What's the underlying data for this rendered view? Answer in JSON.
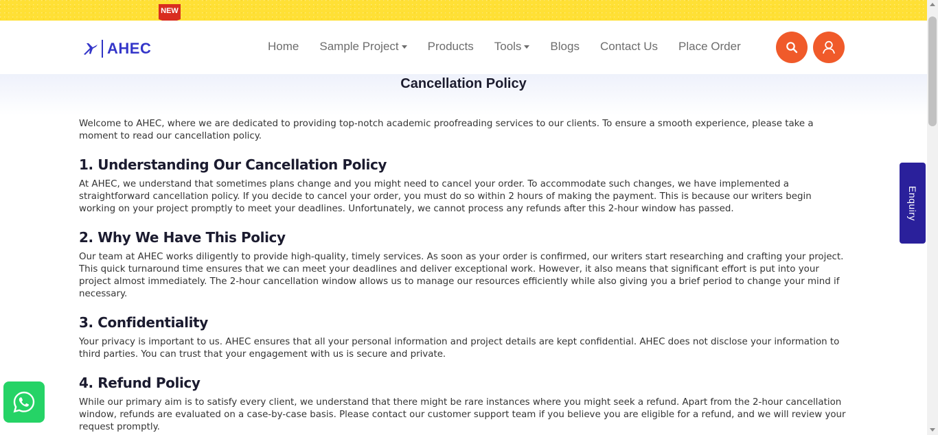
{
  "topbar": {
    "badge": "NEW"
  },
  "brand": {
    "name": "AHEC"
  },
  "nav": {
    "items": [
      {
        "label": "Home"
      },
      {
        "label": "Sample Project",
        "dropdown": true
      },
      {
        "label": "Products"
      },
      {
        "label": "Tools",
        "dropdown": true
      },
      {
        "label": "Blogs"
      },
      {
        "label": "Contact Us"
      },
      {
        "label": "Place Order"
      }
    ]
  },
  "icons": {
    "search": "search-icon",
    "user": "user-icon",
    "whatsapp": "whatsapp-icon",
    "logo": "plane-logo-icon"
  },
  "colors": {
    "accent": "#f05a2a",
    "brand": "#3436c9",
    "topbar": "#ffe035",
    "enquiry": "#2a209b",
    "whatsapp": "#25d366"
  },
  "page": {
    "title": "Cancellation Policy",
    "intro": "Welcome to AHEC, where we are dedicated to providing top-notch academic proofreading services to our clients. To ensure a smooth experience, please take a moment to read our cancellation policy.",
    "sections": [
      {
        "heading": "1. Understanding Our Cancellation Policy",
        "body": "At AHEC, we understand that sometimes plans change and you might need to cancel your order. To accommodate such changes, we have implemented a straightforward cancellation policy. If you decide to cancel your order, you must do so within 2 hours of making the payment. This is because our writers begin working on your project promptly to meet your deadlines. Unfortunately, we cannot process any refunds after this 2-hour window has passed."
      },
      {
        "heading": "2. Why We Have This Policy",
        "body": "Our team at AHEC works diligently to provide high-quality, timely services. As soon as your order is confirmed, our writers start researching and crafting your project. This quick turnaround time ensures that we can meet your deadlines and deliver exceptional work. However, it also means that significant effort is put into your project almost immediately. The 2-hour cancellation window allows us to manage our resources efficiently while also giving you a brief period to change your mind if necessary."
      },
      {
        "heading": "3. Confidentiality",
        "body": "Your privacy is important to us. AHEC ensures that all your personal information and project details are kept confidential. AHEC does not disclose your information to third parties. You can trust that your engagement with us is secure and private."
      },
      {
        "heading": "4. Refund Policy",
        "body": "While our primary aim is to satisfy every client, we understand that there might be rare instances where you might seek a refund. Apart from the 2-hour cancellation window, refunds are evaluated on a case-by-case basis. Please contact our customer support team if you believe you are eligible for a refund, and we will review your request promptly."
      }
    ]
  },
  "enquiry": {
    "label": "Enquiry"
  }
}
